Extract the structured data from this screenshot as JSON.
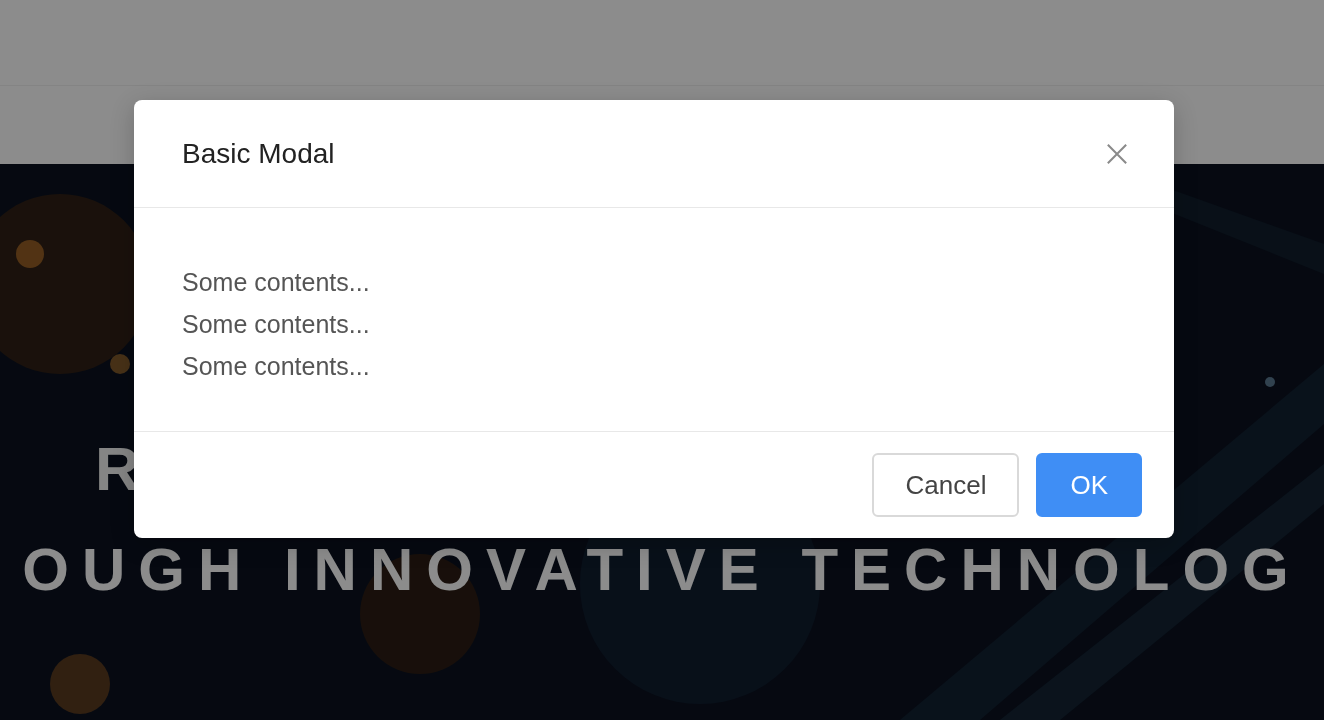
{
  "hero": {
    "lines": [
      "R",
      "OUGH INNOVATIVE TECHNOLOG"
    ]
  },
  "modal": {
    "title": "Basic Modal",
    "body": [
      "Some contents...",
      "Some contents...",
      "Some contents..."
    ],
    "buttons": [
      {
        "label": "Cancel",
        "kind": "default"
      },
      {
        "label": "OK",
        "kind": "primary"
      }
    ]
  }
}
